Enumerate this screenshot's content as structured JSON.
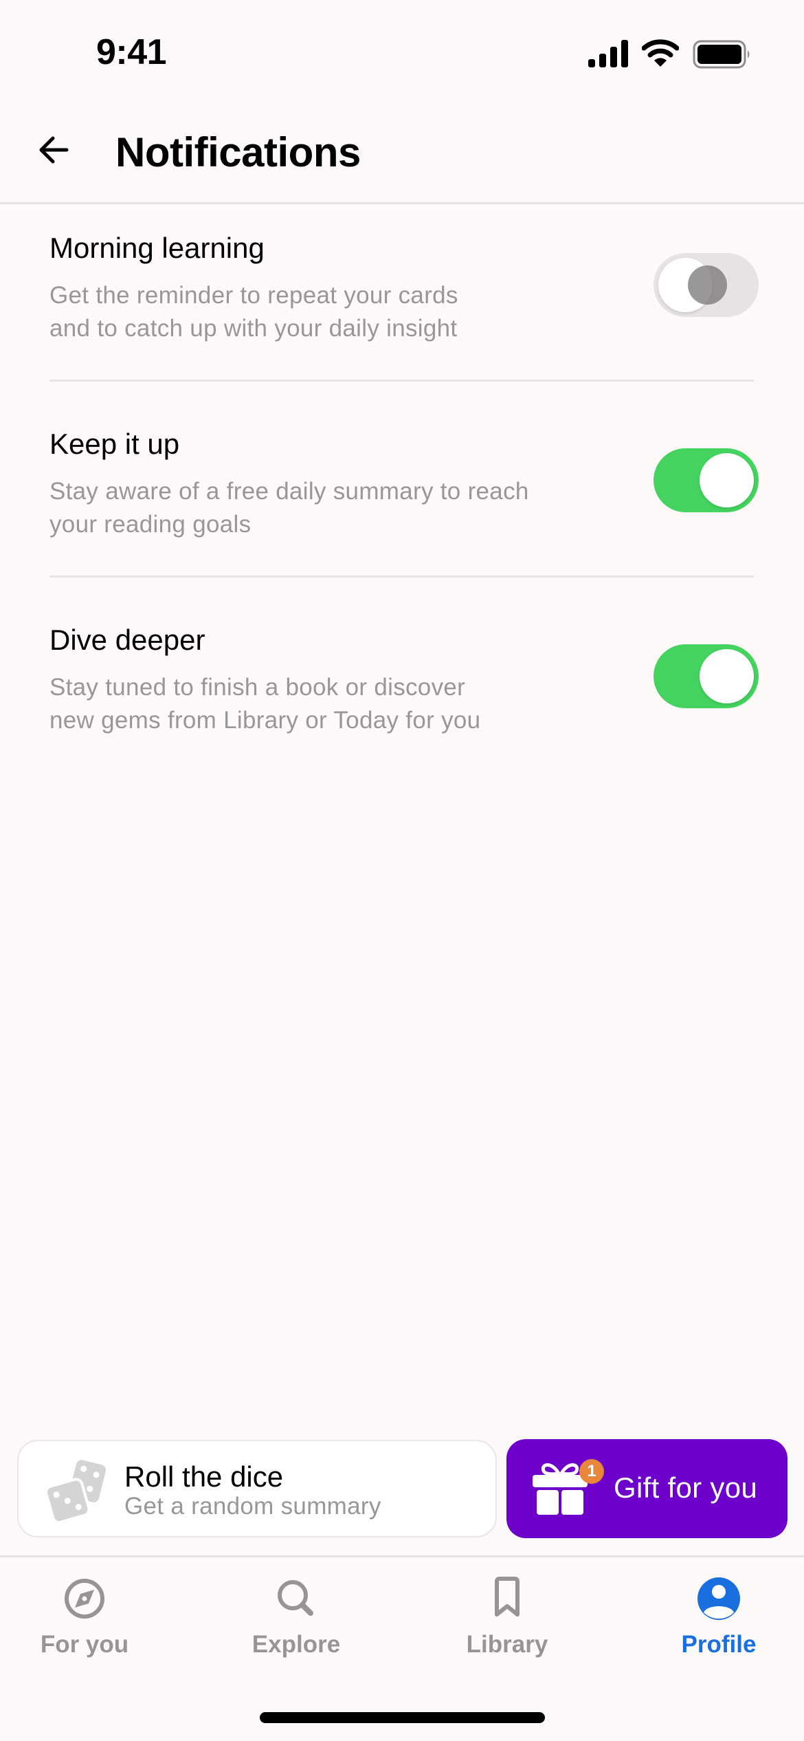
{
  "status_bar": {
    "time": "9:41",
    "icons": [
      "cellular-signal-icon",
      "wifi-icon",
      "battery-icon"
    ]
  },
  "header": {
    "back_icon": "arrow-left-icon",
    "title": "Notifications"
  },
  "settings": [
    {
      "title": "Morning learning",
      "description_lines": [
        "Get the reminder to repeat your cards",
        "and to catch up with your daily insight"
      ],
      "enabled": false
    },
    {
      "title": "Keep it up",
      "description_lines": [
        "Stay aware of a free daily summary to reach",
        "your reading goals"
      ],
      "enabled": true
    },
    {
      "title": "Dive deeper",
      "description_lines": [
        "Stay tuned to finish a book or discover",
        "new gems from Library or Today for you"
      ],
      "enabled": true
    }
  ],
  "actions": {
    "roll_dice": {
      "icon": "dice-icon",
      "title": "Roll the dice",
      "subtitle": "Get a random summary"
    },
    "gift": {
      "icon": "gift-icon",
      "badge_count": "1",
      "label": "Gift for you"
    }
  },
  "tabs": [
    {
      "label": "For you",
      "icon": "compass-icon",
      "active": false
    },
    {
      "label": "Explore",
      "icon": "search-icon",
      "active": false
    },
    {
      "label": "Library",
      "icon": "bookmark-icon",
      "active": false
    },
    {
      "label": "Profile",
      "icon": "profile-icon",
      "active": true
    }
  ],
  "colors": {
    "background": "#FCF9F8",
    "toggle_on": "#43D35E",
    "toggle_off": "#E6E3E2",
    "gift_purple": "#6E00CC",
    "badge_orange": "#E8873A",
    "active_tab": "#1A6FE0",
    "inactive_tab": "#999494",
    "secondary_text": "#9A9696"
  }
}
